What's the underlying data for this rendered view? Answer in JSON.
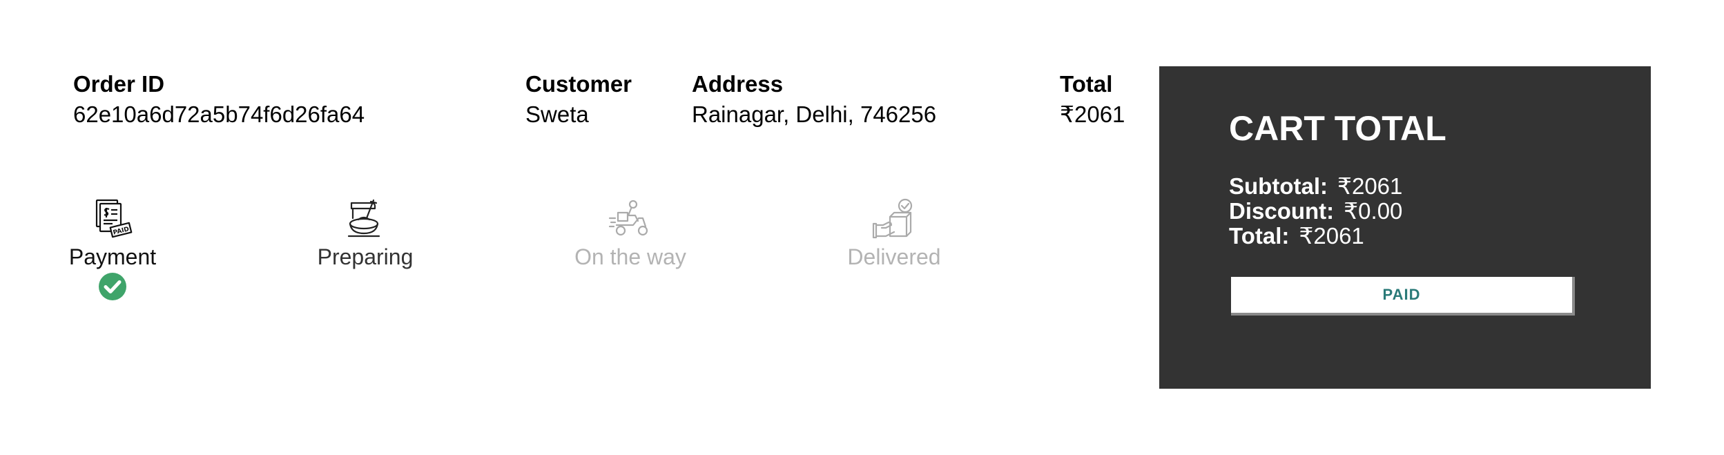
{
  "order": {
    "headers": {
      "order_id": "Order ID",
      "customer": "Customer",
      "address": "Address",
      "total": "Total"
    },
    "values": {
      "order_id": "62e10a6d72a5b74f6d26fa64",
      "customer": "Sweta",
      "address": "Rainagar, Delhi, 746256",
      "total": "₹2061"
    }
  },
  "status": {
    "steps": [
      {
        "label": "Payment",
        "state": "done",
        "icon": "paid-receipt-icon"
      },
      {
        "label": "Preparing",
        "state": "current",
        "icon": "chef-preparing-icon"
      },
      {
        "label": "On the way",
        "state": "pending",
        "icon": "delivery-scooter-icon"
      },
      {
        "label": "Delivered",
        "state": "pending",
        "icon": "delivered-box-icon"
      }
    ],
    "done_color": "#3fa46a"
  },
  "cart": {
    "title": "CART TOTAL",
    "subtotal_label": "Subtotal:",
    "subtotal_value": "₹2061",
    "discount_label": "Discount:",
    "discount_value": "₹0.00",
    "total_label": "Total:",
    "total_value": "₹2061",
    "button_label": "PAID",
    "background": "#333333",
    "button_text_color": "#2a7a78"
  }
}
